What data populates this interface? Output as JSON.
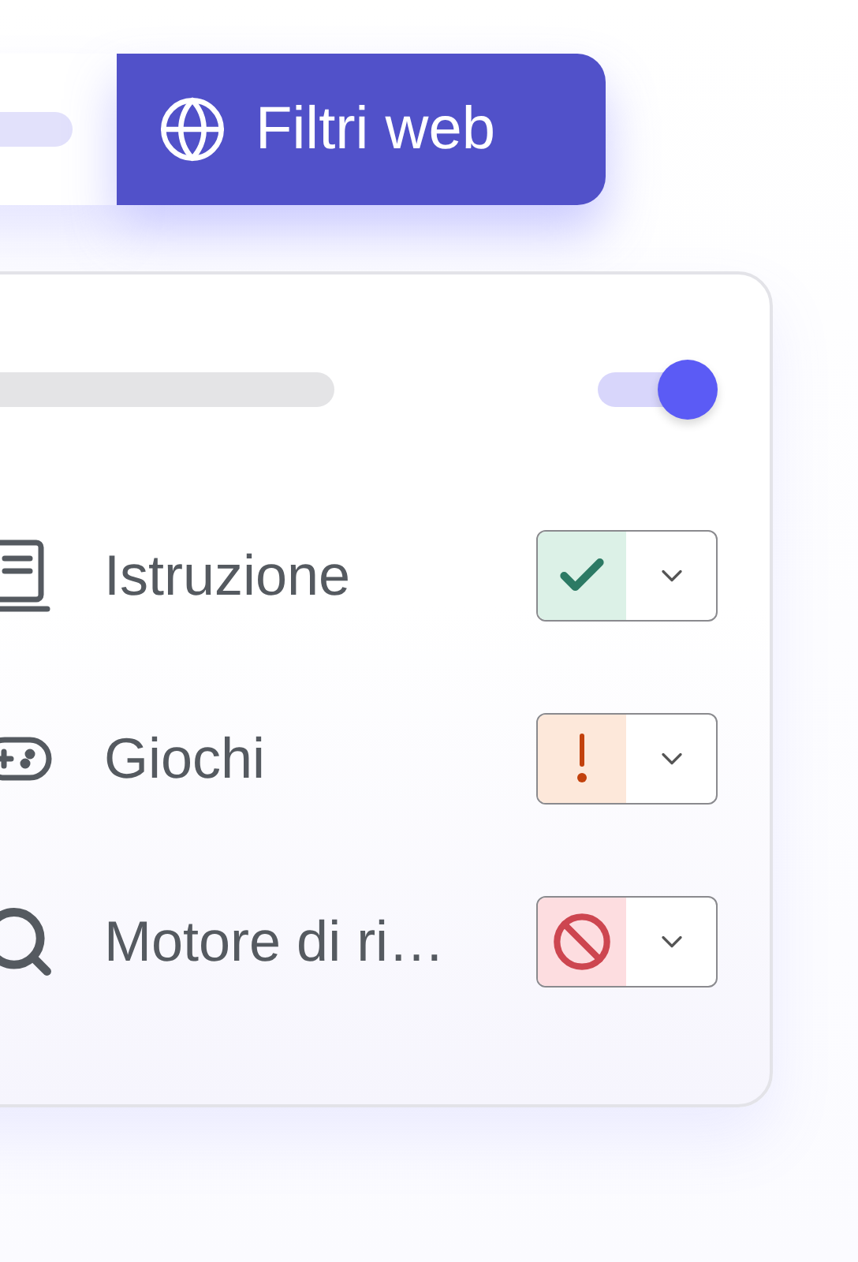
{
  "tabs": [
    {
      "kind": "placeholder",
      "selected": false
    },
    {
      "kind": "label",
      "label": "Filtri web",
      "selected": true
    }
  ],
  "toggle": {
    "on": true
  },
  "categories": [
    {
      "kind": "book",
      "label": "Istruzione",
      "status": {
        "kind": "allowed"
      }
    },
    {
      "kind": "gamepad",
      "label": "Giochi",
      "status": {
        "kind": "warning"
      }
    },
    {
      "kind": "search",
      "label": "Motore di ri…",
      "status": {
        "kind": "blocked"
      }
    }
  ]
}
